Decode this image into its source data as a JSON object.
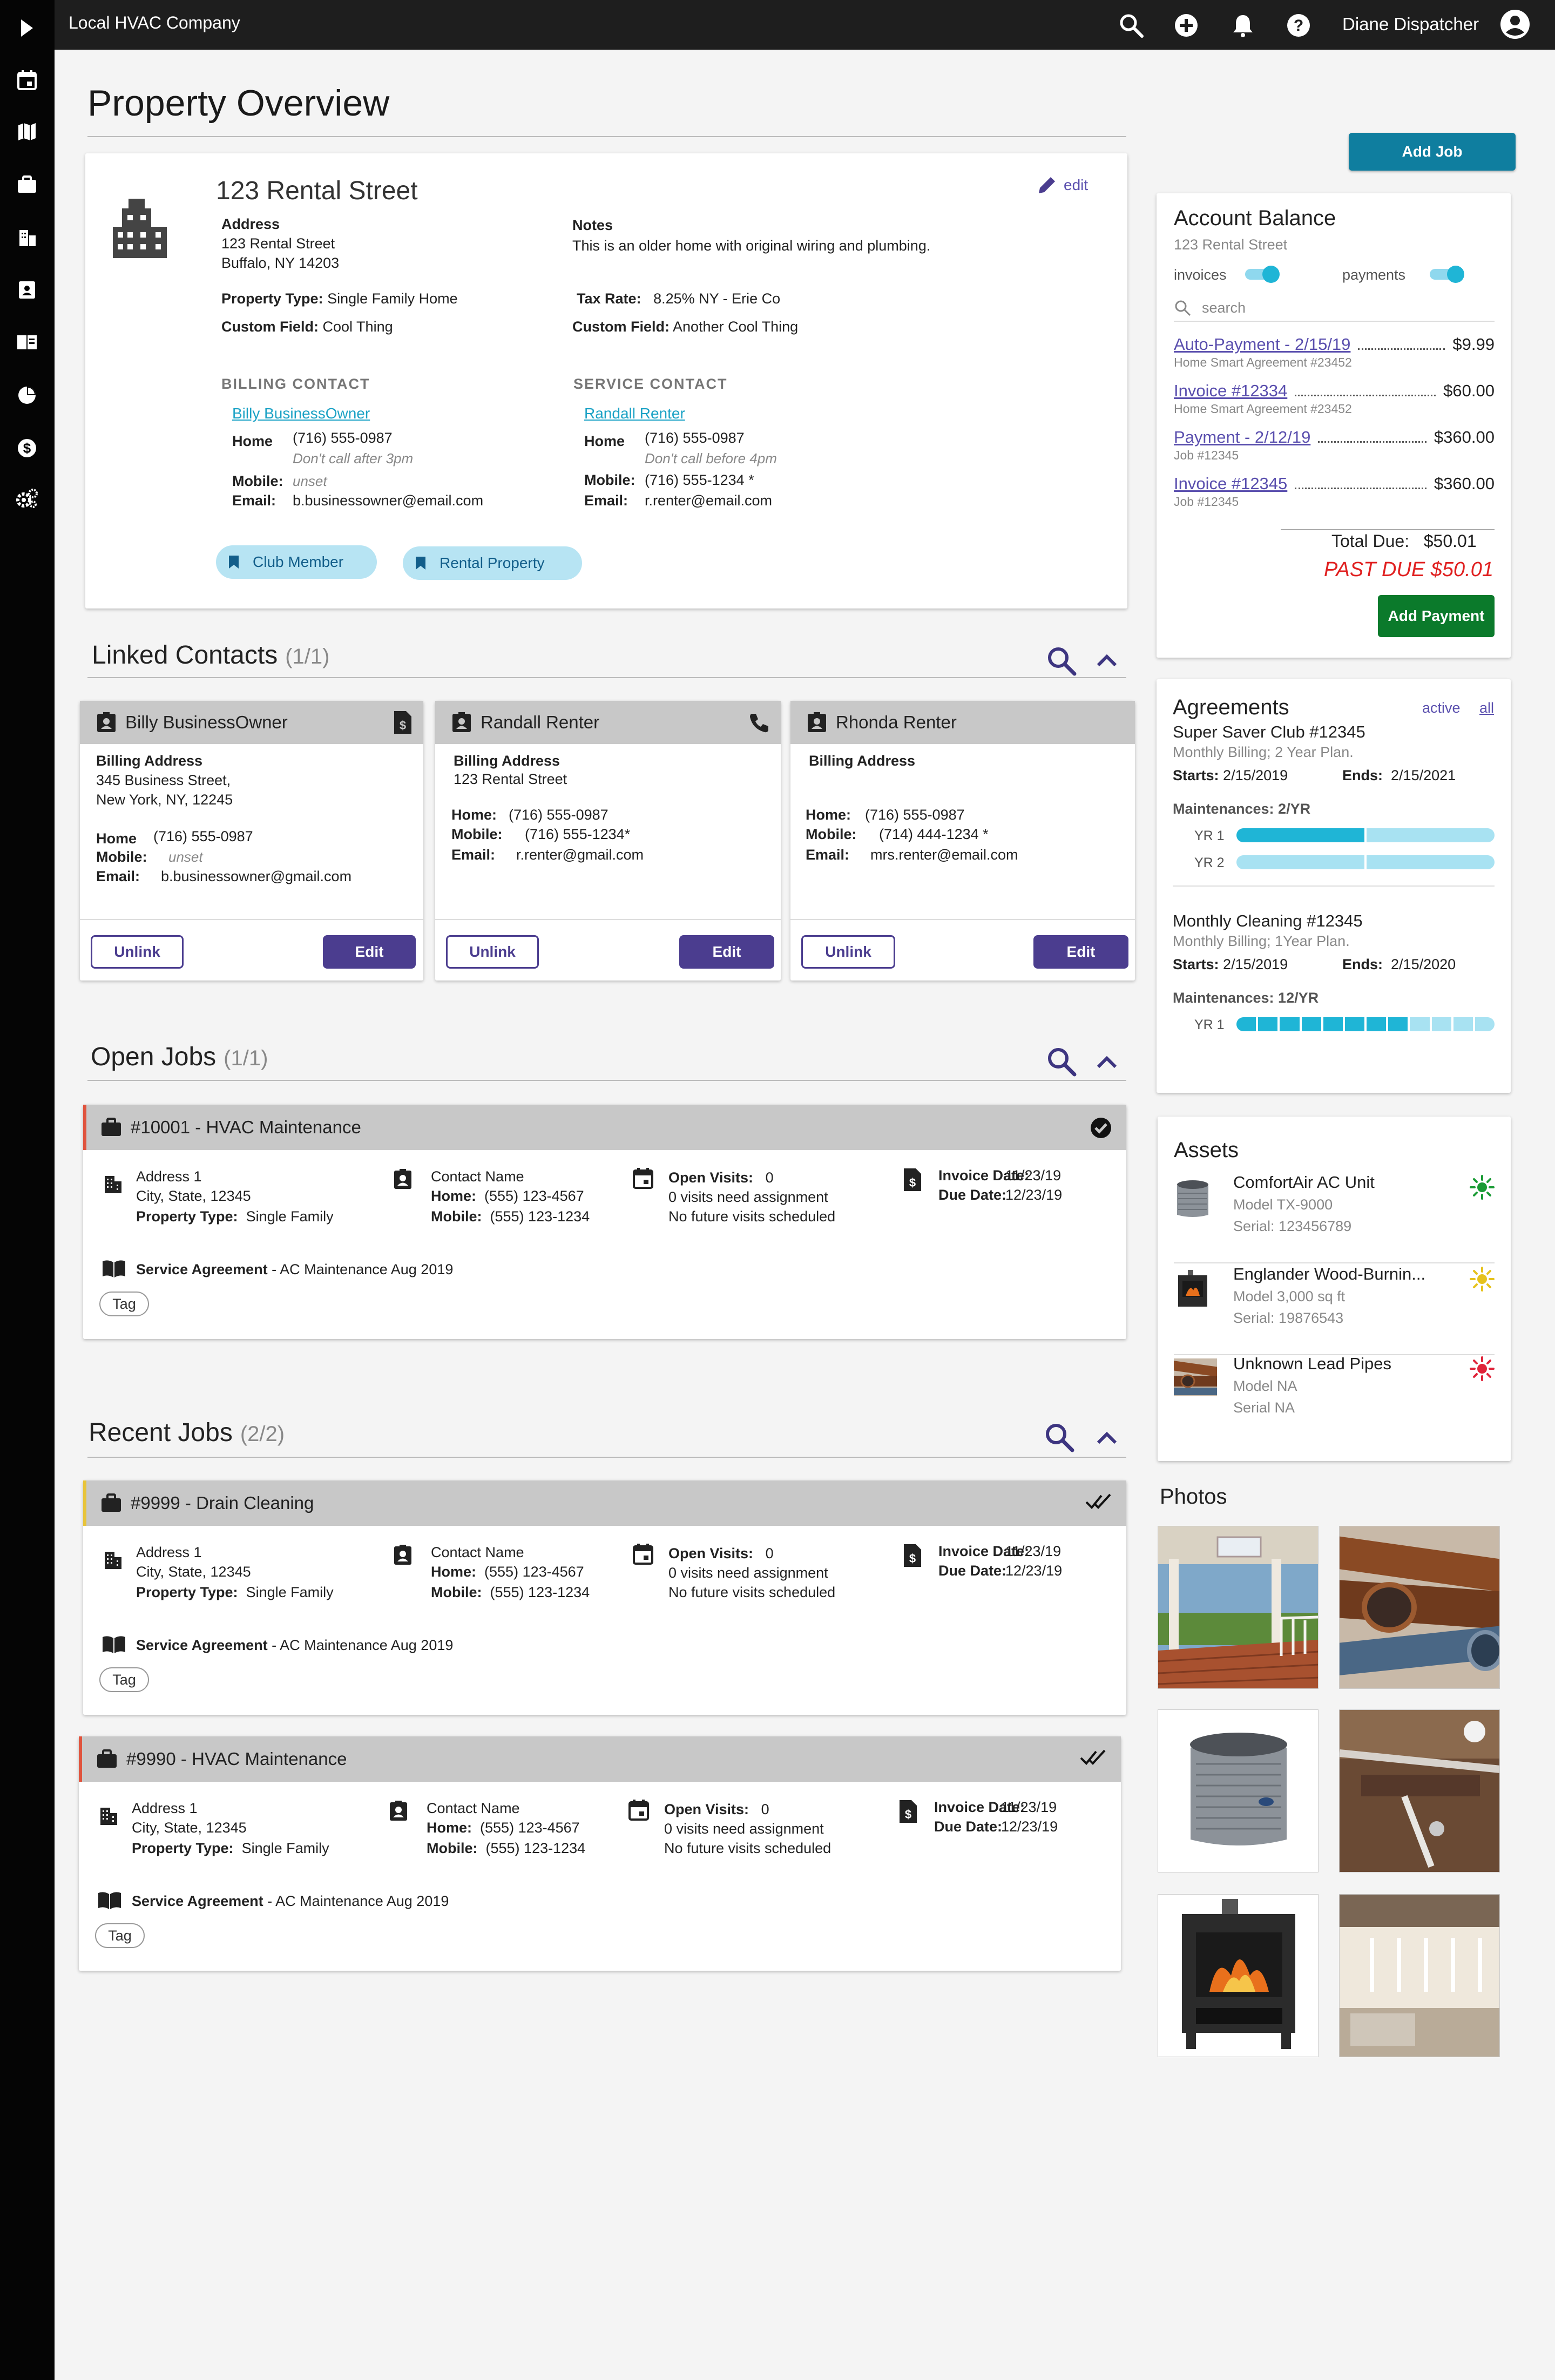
{
  "app": {
    "company": "Local HVAC Company",
    "user": "Diane Dispatcher"
  },
  "page": {
    "title": "Property Overview",
    "add_job": "Add Job"
  },
  "property": {
    "name": "123 Rental Street",
    "edit": "edit",
    "address_label": "Address",
    "address_line1": "123 Rental Street",
    "address_line2": "Buffalo, NY 14203",
    "notes_label": "Notes",
    "notes": "This is an older home with original wiring and plumbing.",
    "type_label": "Property Type:",
    "type": "Single Family Home",
    "custom_label": "Custom Field:",
    "custom": "Cool Thing",
    "tax_label": "Tax Rate:",
    "tax": "8.25%  NY - Erie Co",
    "custom2_label": "Custom Field:",
    "custom2": "Another Cool Thing",
    "billing": {
      "heading": "BILLING CONTACT",
      "name": "Billy BusinessOwner",
      "home_label": "Home",
      "home": "(716) 555-0987",
      "note": "Don't call after 3pm",
      "mobile_label": "Mobile:",
      "mobile": "unset",
      "email_label": "Email:",
      "email": "b.businessowner@email.com"
    },
    "service": {
      "heading": "SERVICE CONTACT",
      "name": "Randall Renter",
      "home_label": "Home",
      "home": "(716) 555-0987",
      "note": "Don't call before 4pm",
      "mobile_label": "Mobile:",
      "mobile": "(716) 555-1234 *",
      "email_label": "Email:",
      "email": "r.renter@email.com"
    },
    "chips": [
      "Club Member",
      "Rental Property"
    ]
  },
  "linked": {
    "title": "Linked Contacts",
    "count": "(1/1)",
    "contacts": [
      {
        "name": "Billy BusinessOwner",
        "billing_label": "Billing Address",
        "addr1": "345 Business Street,",
        "addr2": "New York, NY, 12245",
        "home_label": "Home",
        "home": "(716) 555-0987",
        "mobile_label": "Mobile:",
        "mobile": "unset",
        "email_label": "Email:",
        "email": "b.businessowner@gmail.com",
        "unlink": "Unlink",
        "edit": "Edit"
      },
      {
        "name": "Randall Renter",
        "billing_label": "Billing Address",
        "addr1": "123 Rental Street",
        "addr2": "",
        "home_label": "Home:",
        "home": "(716) 555-0987",
        "mobile_label": "Mobile:",
        "mobile": "(716) 555-1234*",
        "email_label": "Email:",
        "email": "r.renter@gmail.com",
        "unlink": "Unlink",
        "edit": "Edit"
      },
      {
        "name": "Rhonda Renter",
        "billing_label": "Billing Address",
        "addr1": "",
        "addr2": "",
        "home_label": "Home:",
        "home": "(716) 555-0987",
        "mobile_label": "Mobile:",
        "mobile": "(714) 444-1234 *",
        "email_label": "Email:",
        "email": "mrs.renter@email.com",
        "unlink": "Unlink",
        "edit": "Edit"
      }
    ]
  },
  "open_jobs": {
    "title": "Open Jobs",
    "count": "(1/1)"
  },
  "recent_jobs": {
    "title": "Recent Jobs",
    "count": "(2/2)"
  },
  "jobs": [
    {
      "title": "#10001 - HVAC Maintenance",
      "accent": "#e0533d",
      "status": "check-circle-icon",
      "addr1": "Address 1",
      "addr2": "City, State, 12345",
      "ptype_label": "Property Type:",
      "ptype": "Single Family",
      "contact": "Contact Name",
      "home_label": "Home:",
      "home": "(555) 123-4567",
      "mobile_label": "Mobile:",
      "mobile": "(555) 123-1234",
      "visits_label": "Open Visits:",
      "visits": "0",
      "visits_line2": "0 visits need assignment",
      "visits_line3": "No future visits scheduled",
      "inv_label": "Invoice Date:",
      "inv": "11/23/19",
      "due_label": "Due Date:",
      "due": "12/23/19",
      "sa_label": "Service Agreement",
      "sa": " - AC Maintenance Aug 2019",
      "tag": "Tag"
    },
    {
      "title": "#9999 - Drain Cleaning",
      "accent": "#e8c43a",
      "status": "double-check-icon",
      "addr1": "Address 1",
      "addr2": "City, State, 12345",
      "ptype_label": "Property Type:",
      "ptype": "Single Family",
      "contact": "Contact Name",
      "home_label": "Home:",
      "home": "(555) 123-4567",
      "mobile_label": "Mobile:",
      "mobile": "(555) 123-1234",
      "visits_label": "Open Visits:",
      "visits": "0",
      "visits_line2": "0 visits need assignment",
      "visits_line3": "No future visits scheduled",
      "inv_label": "Invoice Date:",
      "inv": "11/23/19",
      "due_label": "Due Date:",
      "due": "12/23/19",
      "sa_label": "Service Agreement",
      "sa": " - AC Maintenance Aug 2019",
      "tag": "Tag"
    },
    {
      "title": "#9990 - HVAC Maintenance",
      "accent": "#e0533d",
      "status": "double-check-icon",
      "addr1": "Address 1",
      "addr2": "City, State, 12345",
      "ptype_label": "Property Type:",
      "ptype": "Single Family",
      "contact": "Contact Name",
      "home_label": "Home:",
      "home": "(555) 123-4567",
      "mobile_label": "Mobile:",
      "mobile": "(555) 123-1234",
      "visits_label": "Open Visits:",
      "visits": "0",
      "visits_line2": "0 visits need assignment",
      "visits_line3": "No future visits scheduled",
      "inv_label": "Invoice Date:",
      "inv": "11/23/19",
      "due_label": "Due Date:",
      "due": "12/23/19",
      "sa_label": "Service Agreement",
      "sa": " - AC Maintenance Aug 2019",
      "tag": "Tag"
    }
  ],
  "balance": {
    "title": "Account Balance",
    "subtitle": "123 Rental Street",
    "invoices_label": "invoices",
    "payments_label": "payments",
    "search_placeholder": "search",
    "items": [
      {
        "label": "Auto-Payment - 2/15/19",
        "sub": "Home Smart Agreement #23452",
        "amount": "$9.99"
      },
      {
        "label": "Invoice #12334",
        "sub": "Home Smart Agreement #23452",
        "amount": "$60.00"
      },
      {
        "label": "Payment - 2/12/19",
        "sub": "Job #12345",
        "amount": "$360.00"
      },
      {
        "label": "Invoice #12345",
        "sub": "Job #12345",
        "amount": "$360.00"
      }
    ],
    "total_label": "Total Due:",
    "total": "$50.01",
    "past_due": "PAST DUE $50.01",
    "add_payment": "Add Payment"
  },
  "agreements": {
    "title": "Agreements",
    "active": "active",
    "all": "all",
    "items": [
      {
        "name": "Super Saver Club #12345",
        "desc": "Monthly Billing; 2 Year Plan.",
        "starts_label": "Starts:",
        "starts": "2/15/2019",
        "ends_label": "Ends:",
        "ends": "2/15/2021",
        "maint": "Maintenances: 2/YR",
        "rows": [
          {
            "label": "YR 1",
            "done": 1,
            "total": 2
          },
          {
            "label": "YR 2",
            "done": 0,
            "total": 2
          }
        ]
      },
      {
        "name": "Monthly Cleaning #12345",
        "desc": "Monthly Billing; 1Year Plan.",
        "starts_label": "Starts:",
        "starts": "2/15/2019",
        "ends_label": "Ends:",
        "ends": "2/15/2020",
        "maint": "Maintenances: 12/YR",
        "rows": [
          {
            "label": "YR 1",
            "done": 8,
            "total": 12
          }
        ]
      }
    ]
  },
  "assets": {
    "title": "Assets",
    "items": [
      {
        "name": "ComfortAir AC Unit",
        "model": "Model TX-9000",
        "serial": "Serial: 123456789",
        "status_color": "#1a9b35"
      },
      {
        "name": "Englander Wood-Burnin...",
        "model": "Model 3,000 sq ft",
        "serial": "Serial: 19876543",
        "status_color": "#e6c21c"
      },
      {
        "name": "Unknown Lead Pipes",
        "model": "Model NA",
        "serial": "Serial NA",
        "status_color": "#e0243a"
      }
    ]
  },
  "photos": {
    "title": "Photos"
  },
  "colors": {
    "brand_button": "#0f7e9f",
    "accent_purple": "#4b3d8f",
    "teal": "#1fb5d6",
    "green": "#0b7a2b",
    "past_due": "#e02020"
  }
}
